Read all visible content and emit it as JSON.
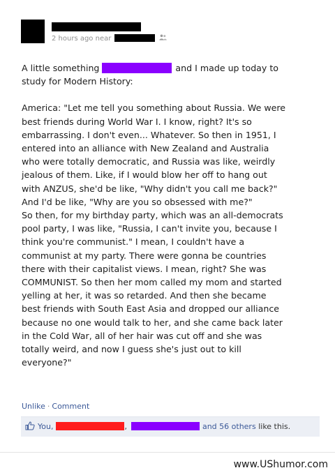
{
  "post": {
    "meta": {
      "timestamp": "2 hours ago near",
      "audience_icon": "friends-icon"
    },
    "intro": {
      "before": "A little something",
      "after": "and I made up today to",
      "line2": "study for Modern History:"
    },
    "body_lines": [
      "America: \"Let me tell you something about Russia. We were",
      "best friends during World War I. I know, right? It's so",
      "embarrassing. I don't even... Whatever. So then in 1951, I",
      "entered into an alliance with New Zealand and Australia",
      "who were totally democratic, and Russia was like, weirdly",
      "jealous of them. Like, if I would blow her off to hang out",
      "with ANZUS, she'd be like, \"Why didn't you call me back?\"",
      "And I'd be like, \"Why are you so obsessed with me?\"",
      "So then, for my birthday party, which was an all-democrats",
      "pool party, I was like, \"Russia, I can't invite you, because I",
      "think you're communist.\" I mean, I couldn't have a",
      "communist at my party. There were gonna be countries",
      "there with their capitalist views. I mean, right? She was",
      "COMMUNIST. So then her mom called my mom and started",
      "yelling at her, it was so retarded. And then she became",
      "best friends with South East Asia and dropped our alliance",
      "because no one would talk to her, and she came back later",
      "in the Cold War, all of her hair was cut off and she was",
      "totally weird, and now I guess she's just out to kill",
      "everyone?\""
    ],
    "actions": {
      "unlike": "Unlike",
      "separator": "·",
      "comment": "Comment"
    },
    "likes": {
      "icon": "thumbs-up-icon",
      "you": "You,",
      "comma": ",",
      "others": "and 56 others",
      "suffix": "like this."
    }
  },
  "watermark": "www.UShumor.com",
  "colors": {
    "link": "#3b5998",
    "redact_purple": "#8a00ff",
    "redact_red": "#ff1d1d",
    "likes_bg": "#eceff5"
  }
}
